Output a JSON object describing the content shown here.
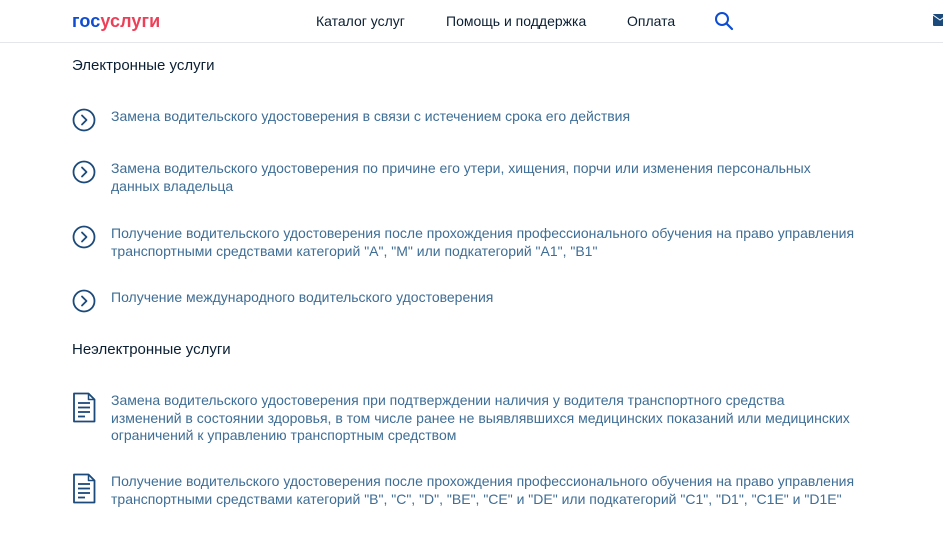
{
  "header": {
    "logo": {
      "part1": "гос",
      "part2": "услуги"
    },
    "nav": {
      "catalog": "Каталог услуг",
      "help": "Помощь и поддержка",
      "payment": "Оплата"
    },
    "icons": {
      "search": "search-icon",
      "mail": "mail-icon"
    }
  },
  "electronic": {
    "title": "Электронные услуги",
    "items": [
      "Замена водительского удостоверения в связи с истечением срока его действия",
      "Замена водительского удостоверения по причине его утери, хищения, порчи или изменения персональных данных владельца",
      "Получение водительского удостоверения после прохождения профессионального обучения на право управления транспортными средствами категорий \"A\", \"M\" или подкатегорий \"A1\", \"B1\"",
      "Получение международного водительского удостоверения"
    ]
  },
  "non_electronic": {
    "title": "Неэлектронные услуги",
    "items": [
      "Замена водительского удостоверения при подтверждении наличия у водителя транспортного средства изменений в состоянии здоровья, в том числе ранее не выявлявшихся медицинских показаний или медицинских ограничений к управлению транспортным средством",
      "Получение водительского удостоверения после прохождения профессионального обучения на право управления транспортными средствами категорий \"B\", \"C\", \"D\", \"BE\", \"CE\" и \"DE\" или подкатегорий \"C1\", \"D1\", \"C1E\" и \"D1E\""
    ]
  },
  "colors": {
    "brand_blue": "#0d4cd3",
    "brand_red": "#ee3f58",
    "link": "#3e6d95",
    "icon": "#1c4a7a",
    "text": "#0b1f33"
  }
}
